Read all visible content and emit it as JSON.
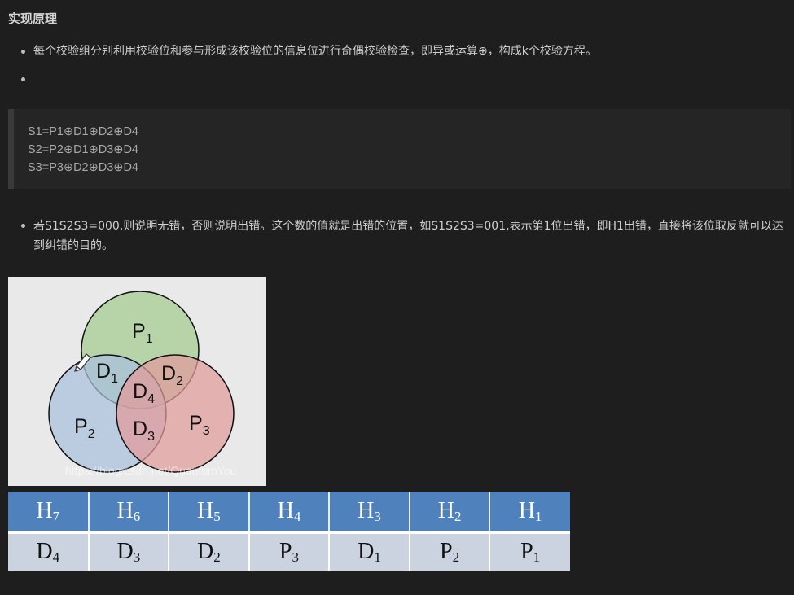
{
  "section": {
    "heading": "实现原理"
  },
  "bullets_top": [
    "每个校验组分别利用校验位和参与形成该校验位的信息位进行奇偶校验检查，即异或运算⊕，构成k个校验方程。",
    ""
  ],
  "code_block": {
    "lines": [
      "S1=P1⊕D1⊕D2⊕D4",
      "S2=P2⊕D1⊕D3⊕D4",
      "S3=P3⊕D2⊕D3⊕D4"
    ]
  },
  "bullets_bottom": [
    "若S1S2S3=000,则说明无错，否则说明出错。这个数的值就是出错的位置，如S1S2S3=001,表示第1位出错，即H1出错，直接将该位取反就可以达到纠错的目的。"
  ],
  "venn": {
    "labels": {
      "p1": {
        "base": "P",
        "sub": "1"
      },
      "p2": {
        "base": "P",
        "sub": "2"
      },
      "p3": {
        "base": "P",
        "sub": "3"
      },
      "d1": {
        "base": "D",
        "sub": "1"
      },
      "d2": {
        "base": "D",
        "sub": "2"
      },
      "d3": {
        "base": "D",
        "sub": "3"
      },
      "d4": {
        "base": "D",
        "sub": "4"
      }
    },
    "colors": {
      "p1": "#a9cd96",
      "p2": "#a9bfdc",
      "p3": "#e29b9b"
    },
    "watermark": "https://blog.csdn.net/QuantumYou"
  },
  "hamming_table": {
    "header": [
      {
        "base": "H",
        "sub": "7"
      },
      {
        "base": "H",
        "sub": "6"
      },
      {
        "base": "H",
        "sub": "5"
      },
      {
        "base": "H",
        "sub": "4"
      },
      {
        "base": "H",
        "sub": "3"
      },
      {
        "base": "H",
        "sub": "2"
      },
      {
        "base": "H",
        "sub": "1"
      }
    ],
    "row": [
      {
        "base": "D",
        "sub": "4"
      },
      {
        "base": "D",
        "sub": "3"
      },
      {
        "base": "D",
        "sub": "2"
      },
      {
        "base": "P",
        "sub": "3"
      },
      {
        "base": "D",
        "sub": "1"
      },
      {
        "base": "P",
        "sub": "2"
      },
      {
        "base": "P",
        "sub": "1"
      }
    ],
    "colors": {
      "header_bg": "#4f81bd",
      "row_bg": "#ccd3e0"
    }
  }
}
